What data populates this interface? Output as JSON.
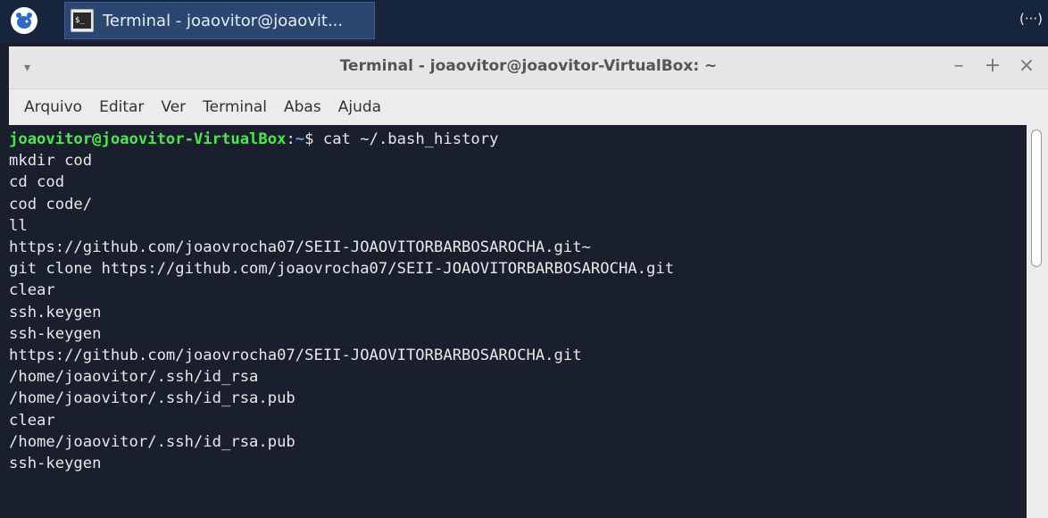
{
  "taskbar": {
    "app_logo_icon": "xubuntu-logo-icon",
    "task_icon": "terminal-icon",
    "task_icon_glyph": "$_",
    "task_label": "Terminal - joaovitor@joaovit...",
    "right_indicator": "(···)"
  },
  "window": {
    "title": "Terminal - joaovitor@joaovitor-VirtualBox: ~",
    "menu_glyph": "▾",
    "minimize_glyph": "–",
    "maximize_glyph": "+",
    "close_glyph": "×"
  },
  "menubar": {
    "items": [
      "Arquivo",
      "Editar",
      "Ver",
      "Terminal",
      "Abas",
      "Ajuda"
    ]
  },
  "terminal": {
    "prompt_user": "joaovitor@joaovitor-VirtualBox",
    "prompt_sep": ":",
    "prompt_path": "~",
    "prompt_symbol": "$ ",
    "command": "cat ~/.bash_history",
    "output_lines": [
      "mkdir cod",
      "cd cod",
      "cod code/",
      "ll",
      "https://github.com/joaovrocha07/SEII-JOAOVITORBARBOSAROCHA.git~",
      "git clone https://github.com/joaovrocha07/SEII-JOAOVITORBARBOSAROCHA.git",
      "clear",
      "ssh.keygen",
      "ssh-keygen",
      "https://github.com/joaovrocha07/SEII-JOAOVITORBARBOSAROCHA.git",
      "/home/joaovitor/.ssh/id_rsa",
      "/home/joaovitor/.ssh/id_rsa.pub",
      "clear",
      "/home/joaovitor/.ssh/id_rsa.pub",
      "ssh-keygen"
    ]
  },
  "colors": {
    "panel_bg": "#16243c",
    "terminal_bg": "#1a1f2e",
    "prompt_user": "#4ee64e",
    "prompt_path": "#6a9fff",
    "text": "#e8e8e8"
  }
}
